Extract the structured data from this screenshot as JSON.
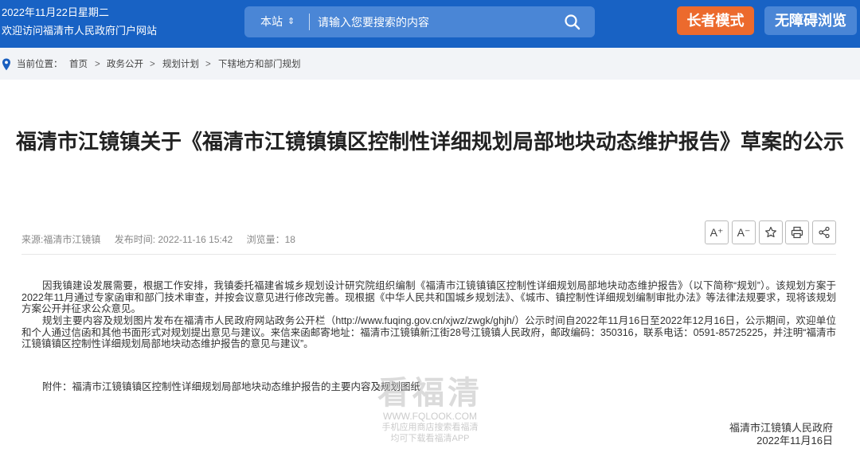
{
  "header": {
    "date": "2022年11月22日星期二",
    "welcome": "欢迎访问福清市人民政府门户网站",
    "search": {
      "scope": "本站",
      "scope_arrow": "⇕",
      "placeholder": "请输入您要搜索的内容"
    },
    "elder_mode": "长者模式",
    "accessible": "无障碍浏览"
  },
  "breadcrumb": {
    "label": "当前位置：",
    "items": [
      "首页",
      "政务公开",
      "规划计划",
      "下辖地方和部门规划"
    ],
    "separator": ">"
  },
  "article": {
    "title": "福清市江镜镇关于《福清市江镜镇镇区控制性详细规划局部地块动态维护报告》草案的公示",
    "source": "来源:福清市江镜镇",
    "published": "发布时间: 2022-11-16 15:42",
    "views": "浏览量：18",
    "tools": {
      "font_up": "A⁺",
      "font_down": "A⁻"
    },
    "para1": "因我镇建设发展需要，根据工作安排，我镇委托福建省城乡规划设计研究院组织编制《福清市江镜镇镇区控制性详细规划局部地块动态维护报告》（以下简称“规划”）。该规划方案于2022年11月通过专家函审和部门技术审查，并按会议意见进行修改完善。现根据《中华人民共和国城乡规划法》、《城市、镇控制性详细规划编制审批办法》等法律法规要求，现将该规划方案公开并征求公众意见。",
    "para2": "规划主要内容及规划图片发布在福清市人民政府网站政务公开栏（http://www.fuqing.gov.cn/xjwz/zwgk/ghjh/）公示时间自2022年11月16日至2022年12月16日，公示期间，欢迎单位和个人通过信函和其他书面形式对规划提出意见与建议。来信来函邮寄地址：福清市江镜镇新江街28号江镜镇人民政府，邮政编码：350316，联系电话：0591-85725225，并注明“福清市江镜镇镇区控制性详细规划局部地块动态维护报告的意见与建议”。",
    "attachment": "附件：福清市江镜镇镇区控制性详细规划局部地块动态维护报告的主要内容及规划图纸",
    "sign_org": "福清市江镜镇人民政府",
    "sign_date": "2022年11月16日"
  },
  "watermark": {
    "title": "看福清",
    "url": "WWW.FQLOOK.COM",
    "line1": "手机应用商店搜索看福清",
    "line2": "均可下载看福清APP"
  },
  "colors": {
    "header_bg": "#1862c4",
    "search_bg": "#4a86d6",
    "elder_btn": "#ec6a2d"
  }
}
